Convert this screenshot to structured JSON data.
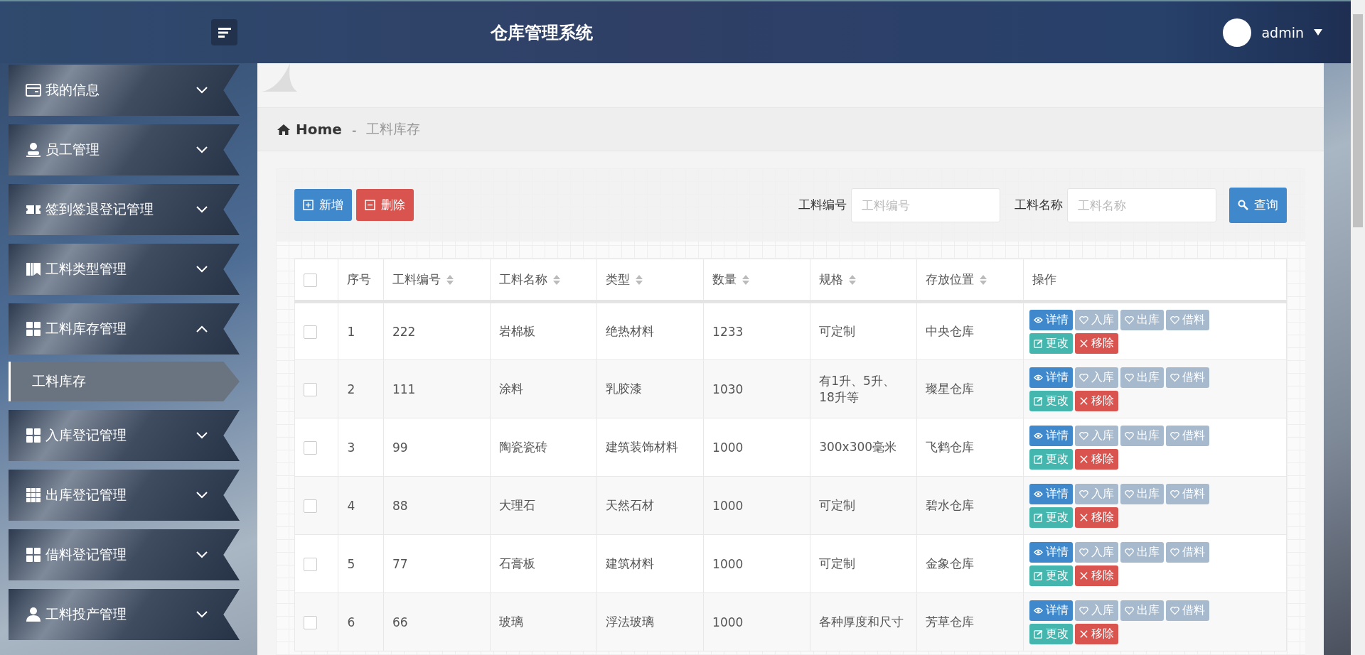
{
  "header": {
    "title": "仓库管理系统",
    "user": "admin"
  },
  "sidebar": {
    "items": [
      {
        "label": "我的信息",
        "expanded": false
      },
      {
        "label": "员工管理",
        "expanded": false
      },
      {
        "label": "签到签退登记管理",
        "expanded": false
      },
      {
        "label": "工料类型管理",
        "expanded": false
      },
      {
        "label": "工料库存管理",
        "expanded": true,
        "children": [
          {
            "label": "工料库存",
            "selected": true
          }
        ]
      },
      {
        "label": "入库登记管理",
        "expanded": false
      },
      {
        "label": "出库登记管理",
        "expanded": false
      },
      {
        "label": "借料登记管理",
        "expanded": false
      },
      {
        "label": "工料投产管理",
        "expanded": false
      }
    ]
  },
  "breadcrumb": {
    "home": "Home",
    "separator": "-",
    "current": "工料库存"
  },
  "toolbar": {
    "buttons": [
      {
        "kind": "add",
        "label": "新增"
      },
      {
        "kind": "delete",
        "label": "删除"
      }
    ],
    "filters": [
      {
        "label": "工料编号",
        "placeholder": "工料编号"
      },
      {
        "label": "工料名称",
        "placeholder": "工料名称"
      }
    ],
    "search": "查询"
  },
  "table": {
    "columns": [
      {
        "label": "序号",
        "sortable": false
      },
      {
        "label": "工料编号",
        "sortable": true
      },
      {
        "label": "工料名称",
        "sortable": true
      },
      {
        "label": "类型",
        "sortable": true
      },
      {
        "label": "数量",
        "sortable": true
      },
      {
        "label": "规格",
        "sortable": true
      },
      {
        "label": "存放位置",
        "sortable": true
      },
      {
        "label": "操作",
        "sortable": false
      }
    ],
    "header_checked": false,
    "rows": [
      {
        "checked": false,
        "cells": [
          "1",
          "222",
          "岩棉板",
          "绝热材料",
          "1233",
          "可定制",
          "中央仓库"
        ],
        "actions": [
          {
            "kind": "detail",
            "label": "详情"
          },
          {
            "kind": "stock-in",
            "label": "入库"
          },
          {
            "kind": "stock-out",
            "label": "出库"
          },
          {
            "kind": "borrow",
            "label": "借料"
          },
          {
            "kind": "edit",
            "label": "更改"
          },
          {
            "kind": "remove",
            "label": "移除"
          }
        ]
      },
      {
        "checked": false,
        "cells": [
          "2",
          "111",
          "涂料",
          "乳胶漆",
          "1030",
          "有1升、5升、18升等",
          "璨星仓库"
        ],
        "actions": [
          {
            "kind": "detail",
            "label": "详情"
          },
          {
            "kind": "stock-in",
            "label": "入库"
          },
          {
            "kind": "stock-out",
            "label": "出库"
          },
          {
            "kind": "borrow",
            "label": "借料"
          },
          {
            "kind": "edit",
            "label": "更改"
          },
          {
            "kind": "remove",
            "label": "移除"
          }
        ]
      },
      {
        "checked": false,
        "cells": [
          "3",
          "99",
          "陶瓷瓷砖",
          "建筑装饰材料",
          "1000",
          "300x300毫米",
          "飞鹤仓库"
        ],
        "actions": [
          {
            "kind": "detail",
            "label": "详情"
          },
          {
            "kind": "stock-in",
            "label": "入库"
          },
          {
            "kind": "stock-out",
            "label": "出库"
          },
          {
            "kind": "borrow",
            "label": "借料"
          },
          {
            "kind": "edit",
            "label": "更改"
          },
          {
            "kind": "remove",
            "label": "移除"
          }
        ]
      },
      {
        "checked": false,
        "cells": [
          "4",
          "88",
          "大理石",
          "天然石材",
          "1000",
          "可定制",
          "碧水仓库"
        ],
        "actions": [
          {
            "kind": "detail",
            "label": "详情"
          },
          {
            "kind": "stock-in",
            "label": "入库"
          },
          {
            "kind": "stock-out",
            "label": "出库"
          },
          {
            "kind": "borrow",
            "label": "借料"
          },
          {
            "kind": "edit",
            "label": "更改"
          },
          {
            "kind": "remove",
            "label": "移除"
          }
        ]
      },
      {
        "checked": false,
        "cells": [
          "5",
          "77",
          "石膏板",
          "建筑材料",
          "1000",
          "可定制",
          "金象仓库"
        ],
        "actions": [
          {
            "kind": "detail",
            "label": "详情"
          },
          {
            "kind": "stock-in",
            "label": "入库"
          },
          {
            "kind": "stock-out",
            "label": "出库"
          },
          {
            "kind": "borrow",
            "label": "借料"
          },
          {
            "kind": "edit",
            "label": "更改"
          },
          {
            "kind": "remove",
            "label": "移除"
          }
        ]
      },
      {
        "checked": false,
        "cells": [
          "6",
          "66",
          "玻璃",
          "浮法玻璃",
          "1000",
          "各种厚度和尺寸",
          "芳草仓库"
        ],
        "actions": [
          {
            "kind": "detail",
            "label": "详情"
          },
          {
            "kind": "stock-in",
            "label": "入库"
          },
          {
            "kind": "stock-out",
            "label": "出库"
          },
          {
            "kind": "borrow",
            "label": "借料"
          },
          {
            "kind": "edit",
            "label": "更改"
          },
          {
            "kind": "remove",
            "label": "移除"
          }
        ]
      }
    ]
  }
}
